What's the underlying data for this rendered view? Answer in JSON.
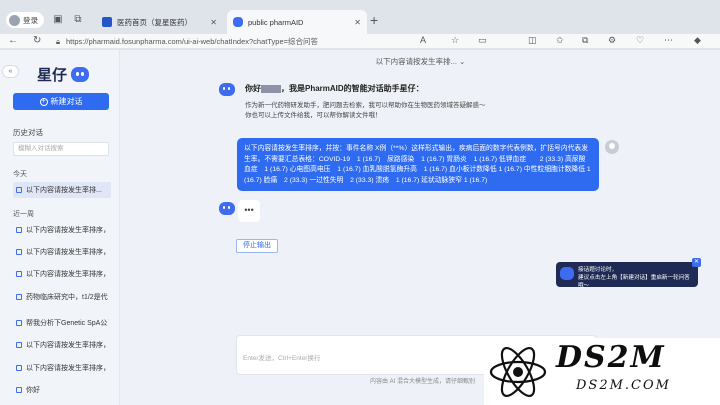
{
  "browser": {
    "profile_label": "登录",
    "tabs": [
      {
        "title": "医药首页（复星医药）",
        "active": false,
        "favicon_color": "#2457c5"
      },
      {
        "title": "public pharmAID",
        "active": true,
        "favicon_color": "#3d6cf0"
      }
    ],
    "url": "https://pharmaid.fosunpharma.com/ui-ai-web/chatIndex?chatType=综合问答"
  },
  "sidebar": {
    "logo_text": "星仔",
    "new_chat_label": "新建对话",
    "history_title": "历史对话",
    "search_placeholder": "模糊入对话搜索",
    "groups": {
      "today_label": "今天",
      "week_label": "近一周"
    },
    "today_items": [
      "以下内容请按发生率排..."
    ],
    "week_items": [
      "以下内容请按发生率排序，...",
      "以下内容请按发生率排序，...",
      "以下内容请按发生率排序，...",
      "药物临床研究中，t1/2是代...",
      "帮我分析下Genetic SpA公司",
      "以下内容请按发生率排序，...",
      "以下内容请按发生率排序，...",
      "你好"
    ]
  },
  "chat": {
    "title": "以下内容请按发生率排...",
    "greeting_prefix": "你好",
    "greeting_suffix": "，我是PharmAID的智能对话助手星仔：",
    "greeting_body_1": "作为新一代药物研发助手，肥问题去检索，我可以帮助你在生物医药领域答疑解惑～",
    "greeting_body_2": "你也可以上传文件给我，可以帮你解读文件哦！",
    "user_message": "以下内容请按发生率排序，并按：事件名称 X例（**%）这样形式输出，疾病后面的数字代表例数，扩括号内代表发生率。不需要汇总表格：COVID-19　1 (16.7)　尿路感染　1 (16.7) 胃肠炎　1 (16.7) 低钾血症　　2 (33.3) 高尿酸血症　1 (16.7) 心电图高电压　1 (16.7) 血乳酸脱氢酶升高　1 (16.7) 血小板计数降低 1 (16.7) 中性粒细胞计数降低 1 (16.7) 脸痛　2 (33.3) 一过性失明　2 (33.3) 溃疡　1 (16.7) 延状动脉狭窄 1 (16.7)",
    "typing_indicator": "•••",
    "stop_label": "停止输出",
    "input_placeholder": "Enter发送，Ctrl+Enter换行",
    "footer_note": "内容由 AI 混合大模型生成，请仔细甄别"
  },
  "notice": {
    "line1": "接话题讨论时，",
    "line2": "建议点击左上角【新建对话】重启新一轮问答哦～"
  },
  "watermark": {
    "big": "DS2M",
    "small": "DS2M.COM"
  },
  "colors": {
    "accent": "#2f6bf0",
    "logo_dark": "#1f2b55",
    "background": "#eef2f8"
  }
}
